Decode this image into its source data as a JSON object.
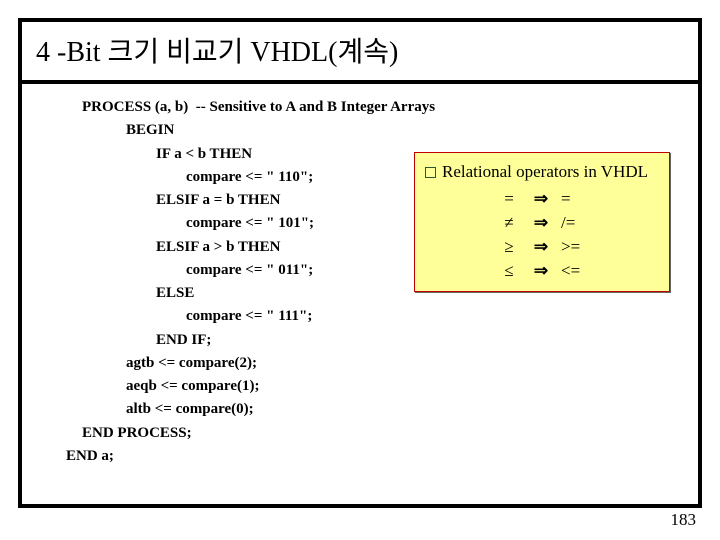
{
  "title": "4 -Bit 크기 비교기 VHDL(계속)",
  "code": {
    "l0": "PROCESS (a, b)  -- Sensitive to A and B Integer Arrays",
    "l1": "BEGIN",
    "l2": "IF a < b THEN",
    "l3": "compare <= \" 110\";",
    "l4": "ELSIF a = b THEN",
    "l5": "compare <= \" 101\";",
    "l6": "ELSIF a > b THEN",
    "l7": "compare <= \" 011\";",
    "l8": "ELSE",
    "l9": "compare <= \" 111\";",
    "l10": "END IF;",
    "l11": "agtb <= compare(2);",
    "l12": "aeqb <= compare(1);",
    "l13": "altb <= compare(0);",
    "l14": "END PROCESS;",
    "l15": "END a;"
  },
  "relops": {
    "heading": "Relational operators in VHDL",
    "rows": [
      {
        "sym": "=",
        "arr": "⇒",
        "rhs": "="
      },
      {
        "sym": "≠",
        "arr": "⇒",
        "rhs": "/="
      },
      {
        "sym": "≥",
        "arr": "⇒",
        "rhs": ">="
      },
      {
        "sym": "≤",
        "arr": "⇒",
        "rhs": "<="
      }
    ]
  },
  "page_number": "183"
}
